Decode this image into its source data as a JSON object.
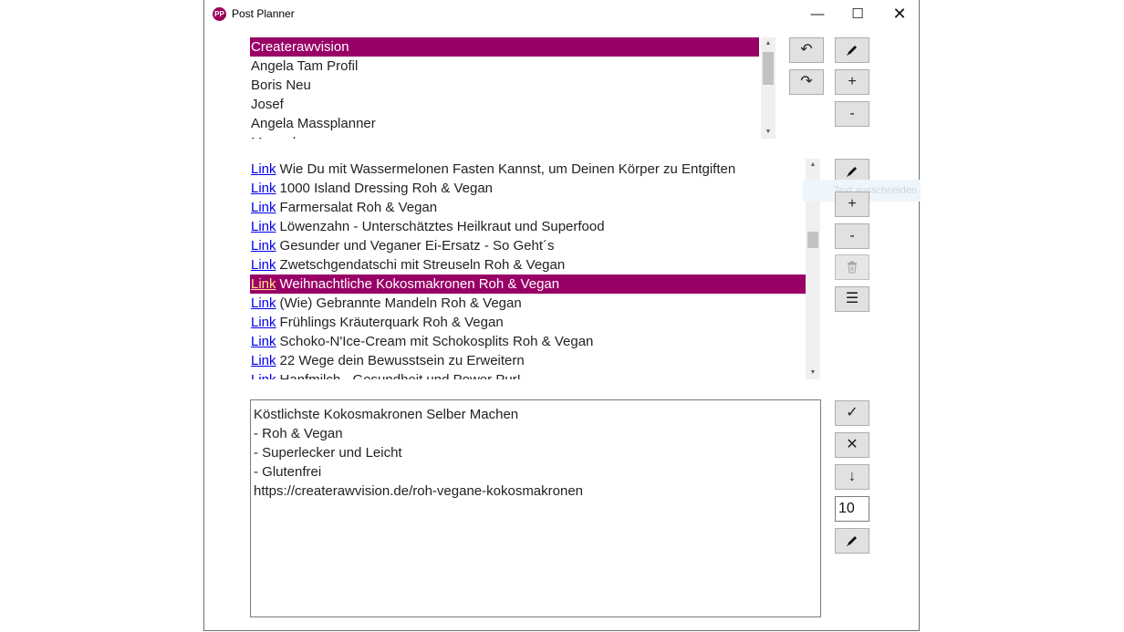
{
  "window": {
    "title": "Post Planner",
    "icon_text": "PP",
    "controls": {
      "minimize": "—",
      "maximize": "☐",
      "close": "✕"
    }
  },
  "profiles": {
    "items": [
      {
        "label": "Createrawvision",
        "selected": true
      },
      {
        "label": "Angela Tam Profil",
        "selected": false
      },
      {
        "label": "Boris Neu",
        "selected": false
      },
      {
        "label": "Josef",
        "selected": false
      },
      {
        "label": "Angela Massplanner",
        "selected": false
      },
      {
        "label": "Manuel",
        "selected": false
      }
    ],
    "buttons": {
      "undo": "↶",
      "redo": "↷",
      "edit": "pen-icon",
      "add": "+",
      "remove": "-"
    }
  },
  "posts": {
    "link_label": "Link",
    "items": [
      {
        "title": "Wie Du mit Wassermelonen Fasten Kannst, um Deinen Körper zu Entgiften",
        "selected": false
      },
      {
        "title": "1000 Island Dressing Roh & Vegan",
        "selected": false
      },
      {
        "title": "Farmersalat Roh & Vegan",
        "selected": false
      },
      {
        "title": "Löwenzahn - Unterschätztes Heilkraut und Superfood",
        "selected": false
      },
      {
        "title": "Gesunder und Veganer Ei-Ersatz - So Geht´s",
        "selected": false
      },
      {
        "title": "Zwetschgendatschi mit Streuseln Roh & Vegan",
        "selected": false
      },
      {
        "title": "Weihnachtliche Kokosmakronen Roh & Vegan",
        "selected": true
      },
      {
        "title": "(Wie) Gebrannte Mandeln Roh & Vegan",
        "selected": false
      },
      {
        "title": "Frühlings Kräuterquark Roh & Vegan",
        "selected": false
      },
      {
        "title": "Schoko-N'Ice-Cream mit Schokosplits Roh & Vegan",
        "selected": false
      },
      {
        "title": "22 Wege dein Bewusstsein zu Erweitern",
        "selected": false
      },
      {
        "title": "Hanfmilch - Gesundheit und Power Pur!",
        "selected": false
      }
    ],
    "buttons": {
      "edit": "pen-icon",
      "add": "+",
      "remove": "-",
      "delete": "trash-icon",
      "menu": "☰"
    },
    "tooltip_fragment": "Text ausschneiden"
  },
  "editor": {
    "lines": [
      "Köstlichste Kokosmakronen Selber Machen",
      "- Roh & Vegan",
      "- Superlecker und Leicht",
      "- Glutenfrei",
      "https://createrawvision.de/roh-vegane-kokosmakronen"
    ],
    "buttons": {
      "confirm": "✓",
      "cancel": "✕",
      "down": "↓",
      "edit": "pen-icon"
    },
    "count_value": "10"
  },
  "colors": {
    "selection": "#990066",
    "link": "#0000ee",
    "app_icon": "#9b005c"
  }
}
